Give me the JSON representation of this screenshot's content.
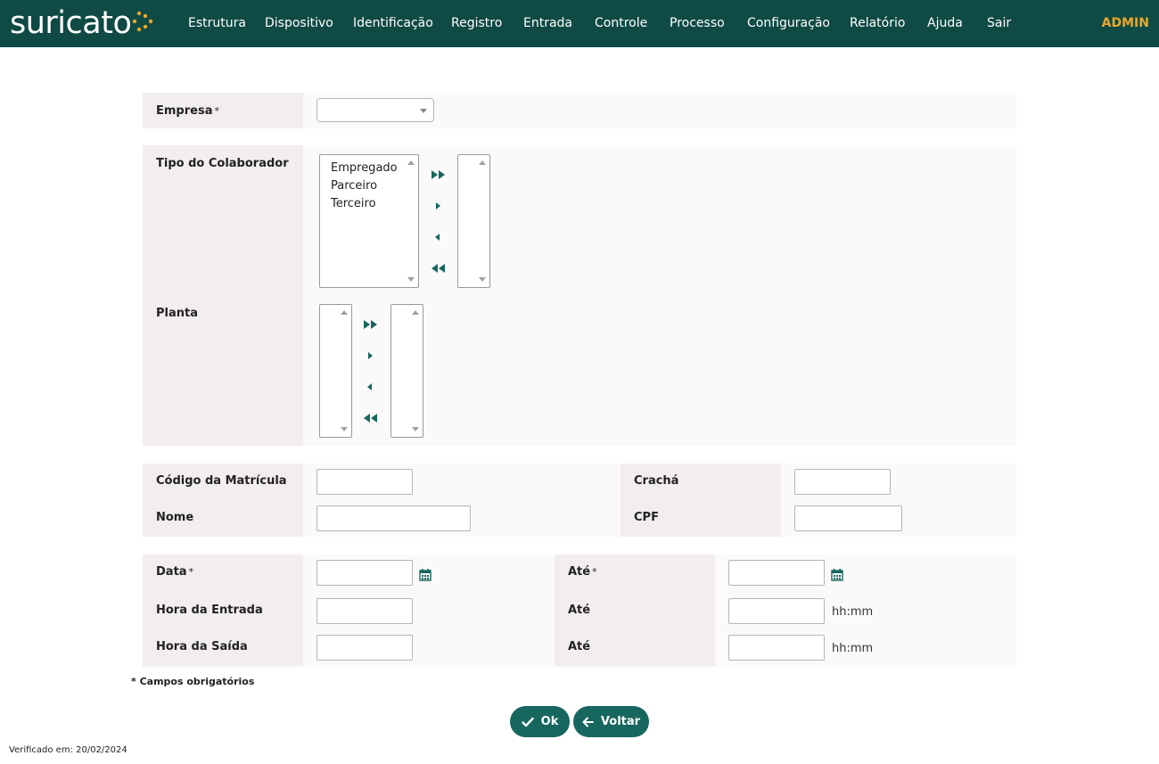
{
  "header": {
    "logo_text": "suricato",
    "nav": [
      "Estrutura",
      "Dispositivo",
      "Identificação",
      "Registro",
      "Entrada",
      "Controle",
      "Processo",
      "Configuração",
      "Relatório",
      "Ajuda",
      "Sair"
    ],
    "user": "ADMIN"
  },
  "form": {
    "empresa": {
      "label": "Empresa",
      "required": "*",
      "value": ""
    },
    "tipo_colaborador": {
      "label": "Tipo do Colaborador",
      "available": [
        "Empregado",
        "Parceiro",
        "Terceiro"
      ],
      "selected": []
    },
    "planta": {
      "label": "Planta",
      "available": [],
      "selected": []
    },
    "codigo_matricula": {
      "label": "Código da Matrícula",
      "value": ""
    },
    "cracha": {
      "label": "Crachá",
      "value": ""
    },
    "nome": {
      "label": "Nome",
      "value": ""
    },
    "cpf": {
      "label": "CPF",
      "value": ""
    },
    "data": {
      "label": "Data",
      "required": "*",
      "value": ""
    },
    "data_ate": {
      "label": "Até",
      "required": "*",
      "value": ""
    },
    "hora_entrada": {
      "label": "Hora da Entrada",
      "value": ""
    },
    "hora_entrada_ate": {
      "label": "Até",
      "value": "",
      "hint": "hh:mm"
    },
    "hora_saida": {
      "label": "Hora da Saída",
      "value": ""
    },
    "hora_saida_ate": {
      "label": "Até",
      "value": "",
      "hint": "hh:mm"
    }
  },
  "required_note": "* Campos obrigatórios",
  "buttons": {
    "ok": "Ok",
    "back": "Voltar"
  },
  "footer": {
    "verified": "Verificado em: 20/02/2024"
  },
  "colors": {
    "header_bg": "#0f4a44",
    "accent": "#17675e",
    "admin": "#e8a82a"
  }
}
